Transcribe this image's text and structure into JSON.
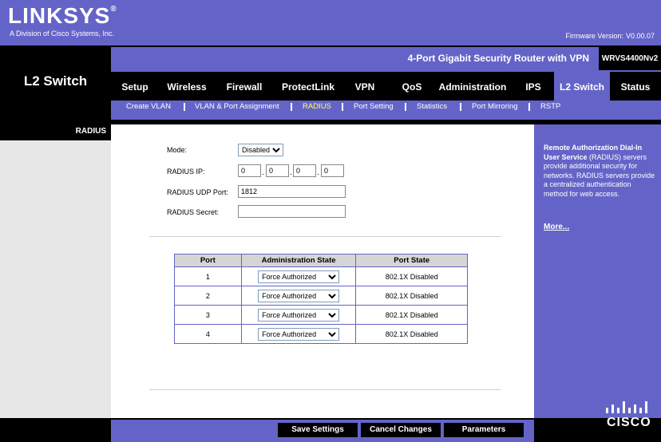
{
  "brand": {
    "logo_text": "LINKSYS",
    "registered": "®",
    "subtitle": "A Division of Cisco Systems, Inc."
  },
  "firmware": {
    "label": "Firmware Version:",
    "value": "V0.00.07"
  },
  "product": {
    "name": "4-Port Gigabit Security Router with VPN",
    "model": "WRVS4400Nv2"
  },
  "section_title": "L2 Switch",
  "nav": {
    "items": [
      {
        "label": "Setup"
      },
      {
        "label": "Wireless"
      },
      {
        "label": "Firewall"
      },
      {
        "label": "ProtectLink"
      },
      {
        "label": "VPN"
      },
      {
        "label": "QoS"
      },
      {
        "label": "Administration"
      },
      {
        "label": "IPS"
      },
      {
        "label": "L2 Switch"
      },
      {
        "label": "Status"
      }
    ],
    "active": "L2 Switch"
  },
  "subnav": {
    "items": [
      {
        "label": "Create VLAN"
      },
      {
        "label": "VLAN & Port Assignment"
      },
      {
        "label": "RADIUS"
      },
      {
        "label": "Port Setting"
      },
      {
        "label": "Statistics"
      },
      {
        "label": "Port Mirroring"
      },
      {
        "label": "RSTP"
      }
    ],
    "active": "RADIUS"
  },
  "left_label": "RADIUS",
  "form": {
    "mode_label": "Mode:",
    "mode_value": "Disabled",
    "radius_ip_label": "RADIUS IP:",
    "radius_ip": [
      "0",
      "0",
      "0",
      "0"
    ],
    "udp_port_label": "RADIUS UDP Port:",
    "udp_port_value": "1812",
    "secret_label": "RADIUS Secret:",
    "secret_value": ""
  },
  "table": {
    "headers": [
      "Port",
      "Administration State",
      "Port State"
    ],
    "rows": [
      {
        "port": "1",
        "admin_state": "Force Authorized",
        "port_state": "802.1X Disabled"
      },
      {
        "port": "2",
        "admin_state": "Force Authorized",
        "port_state": "802.1X Disabled"
      },
      {
        "port": "3",
        "admin_state": "Force Authorized",
        "port_state": "802.1X Disabled"
      },
      {
        "port": "4",
        "admin_state": "Force Authorized",
        "port_state": "802.1X Disabled"
      }
    ]
  },
  "help": {
    "bold": "Remote Authorization Dial-In User Service",
    "text": " (RADIUS) servers provide additional security for networks. RADIUS servers provide a centralized authentication method for web access.",
    "more": "More..."
  },
  "buttons": {
    "save": "Save Settings",
    "cancel": "Cancel Changes",
    "params": "Parameters"
  },
  "footer_logo": "CISCO",
  "colors": {
    "accent": "#6464c8",
    "black": "#000000",
    "grey": "#e7e7e7"
  }
}
